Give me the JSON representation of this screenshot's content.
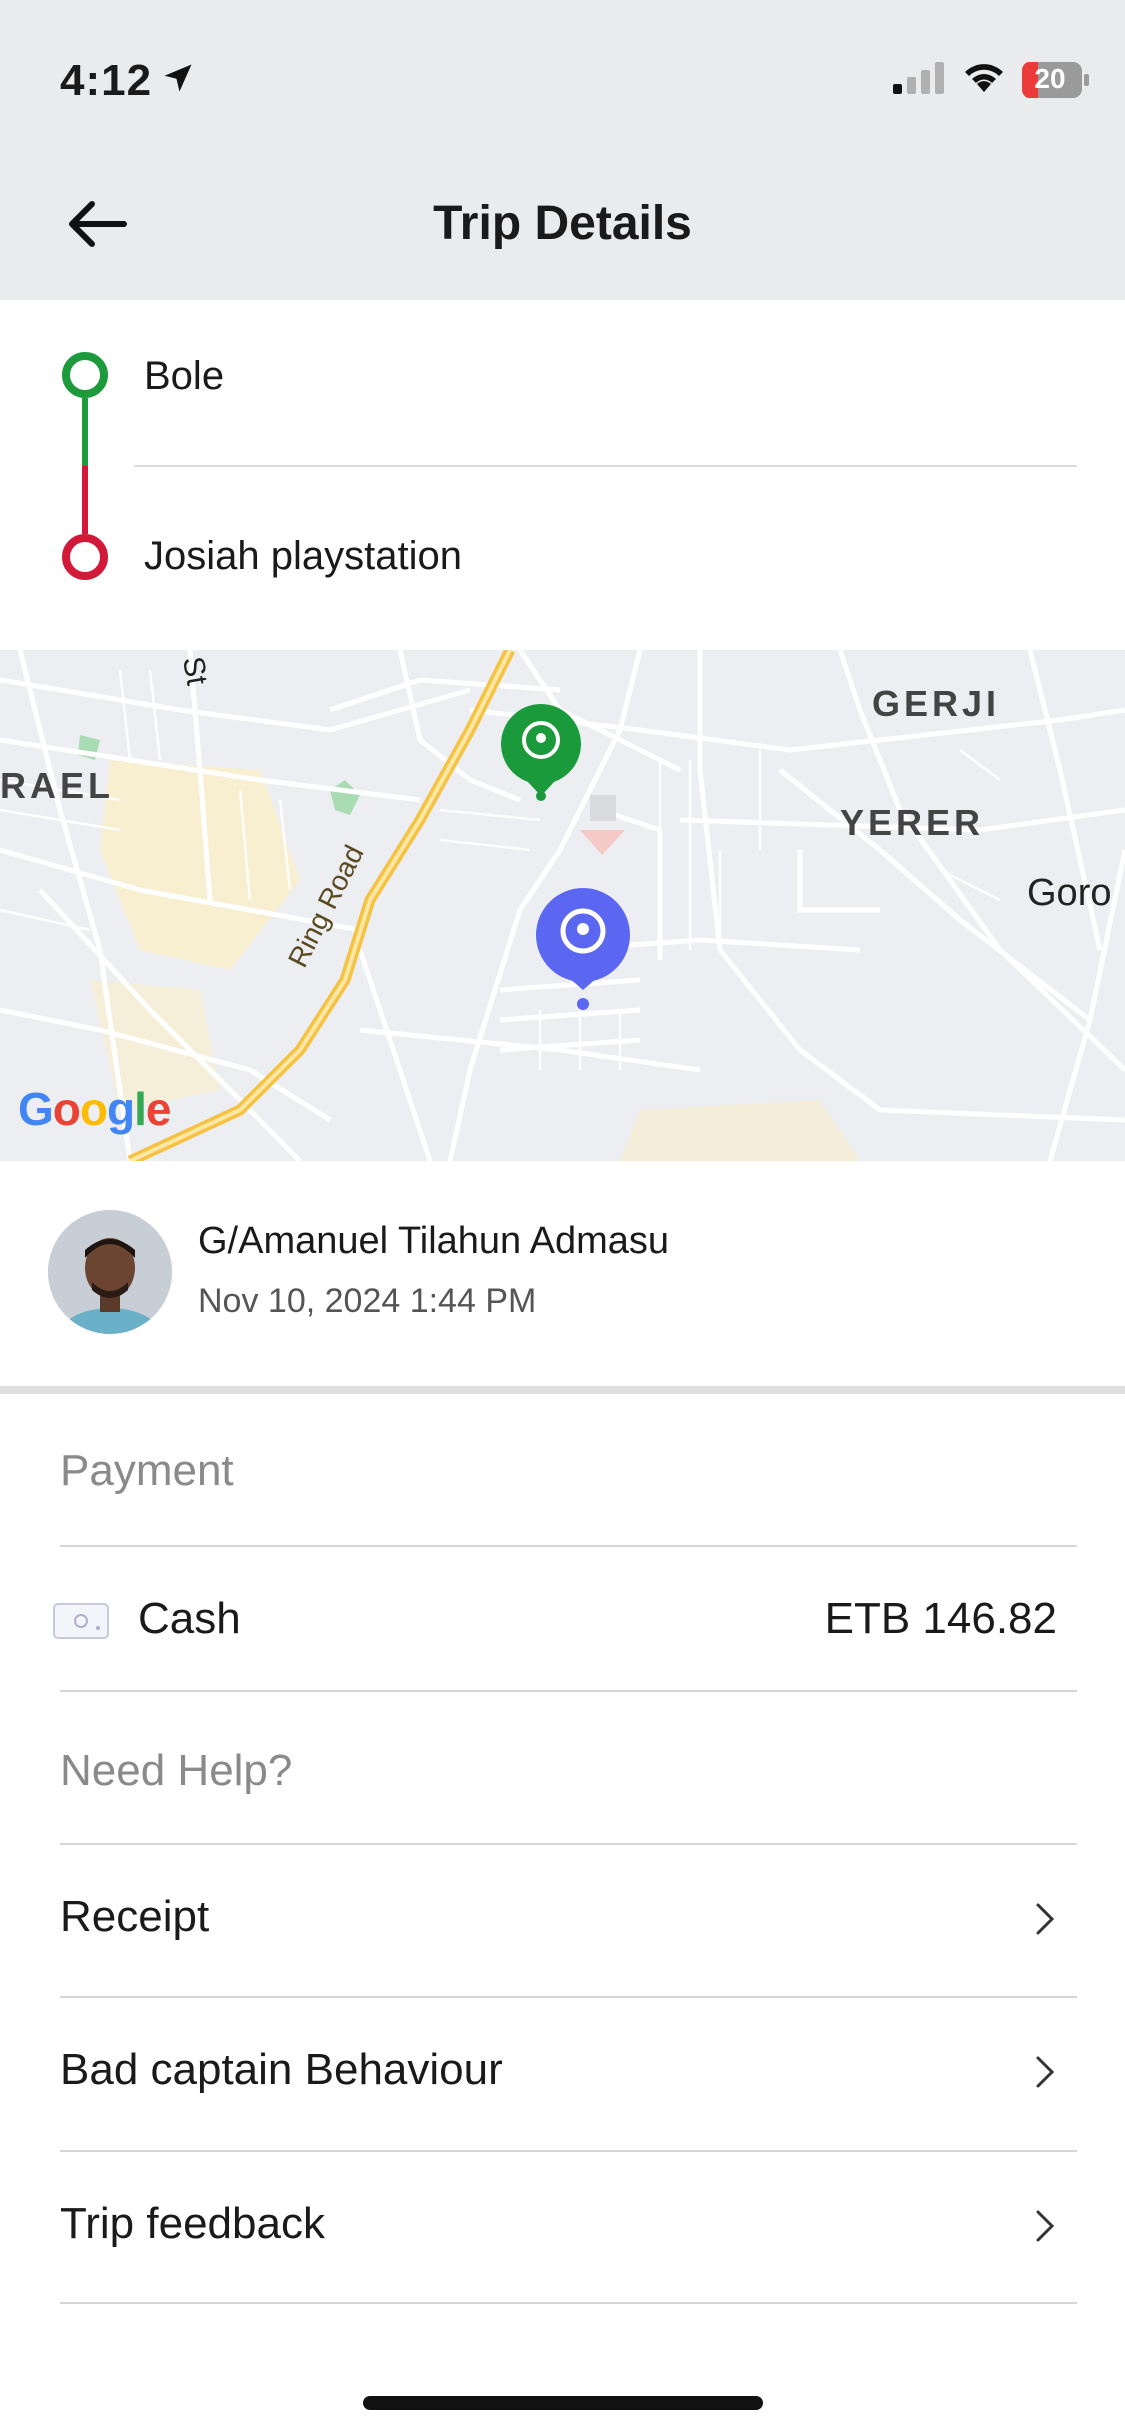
{
  "status_bar": {
    "time": "4:12",
    "battery": "20"
  },
  "header": {
    "title": "Trip Details"
  },
  "route": {
    "pickup": "Bole",
    "dropoff": "Josiah playstation"
  },
  "map": {
    "labels": {
      "gerji": "GERJI",
      "yerer": "YERER",
      "goro": "Goro",
      "rael": "RAEL",
      "st": "St",
      "ring_road": "Ring Road"
    },
    "attribution": "Google",
    "pickup_pin_color": "#1a9a3a",
    "dropoff_pin_color": "#5b67f0"
  },
  "driver": {
    "name": "G/Amanuel  Tilahun Admasu",
    "date": "Nov 10, 2024 1:44 PM"
  },
  "payment": {
    "header": "Payment",
    "method": "Cash",
    "amount": "ETB 146.82"
  },
  "help": {
    "header": "Need Help?",
    "items": [
      {
        "label": "Receipt"
      },
      {
        "label": "Bad captain Behaviour"
      },
      {
        "label": "Trip feedback"
      }
    ]
  },
  "colors": {
    "pickup": "#1d9a3c",
    "dropoff": "#d3193a",
    "header_bg": "#eaebed"
  }
}
